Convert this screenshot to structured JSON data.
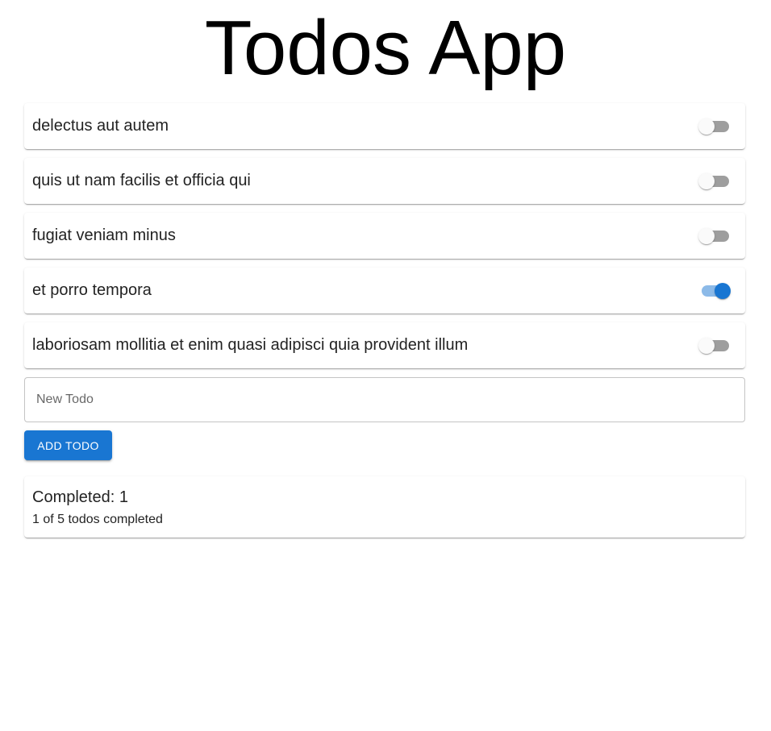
{
  "header": {
    "title": "Todos App"
  },
  "todos": [
    {
      "text": "delectus aut autem",
      "completed": false
    },
    {
      "text": "quis ut nam facilis et officia qui",
      "completed": false
    },
    {
      "text": "fugiat veniam minus",
      "completed": false
    },
    {
      "text": "et porro tempora",
      "completed": true
    },
    {
      "text": "laboriosam mollitia et enim quasi adipisci quia provident illum",
      "completed": false
    }
  ],
  "new_todo": {
    "placeholder": "New Todo",
    "value": ""
  },
  "add_button": {
    "label": "ADD TODO"
  },
  "summary": {
    "completed_label": "Completed: 1",
    "detail": "1 of 5 todos completed"
  },
  "colors": {
    "accent": "#1976d2",
    "switch_off_track": "#9e9e9e",
    "switch_off_thumb": "#fafafa"
  },
  "icons": {
    "switch": "toggle-switch-icon"
  }
}
